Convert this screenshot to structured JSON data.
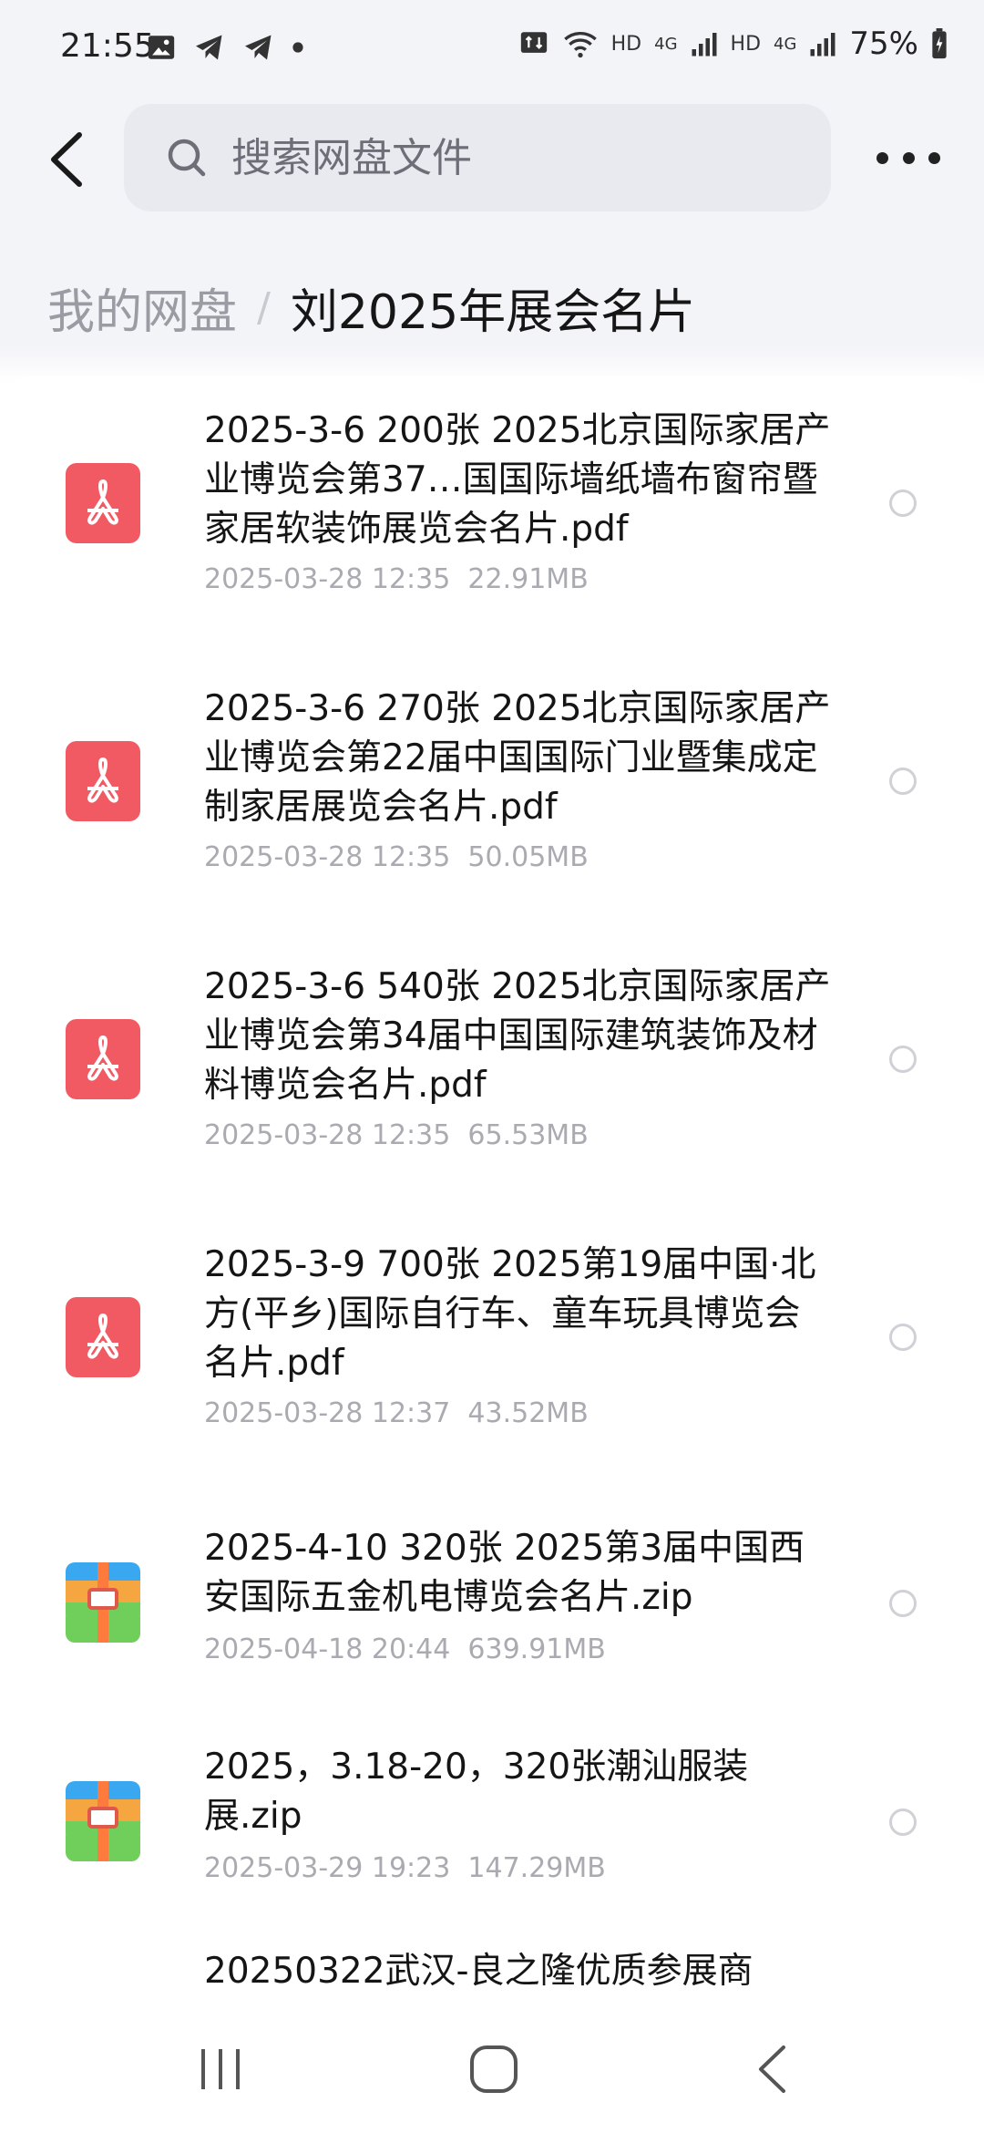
{
  "status_bar": {
    "time": "21:55",
    "net_hd1": "HD",
    "net_4g1": "4G",
    "net_hd2": "HD",
    "net_4g2": "4G",
    "battery": "75%"
  },
  "search": {
    "placeholder": "搜索网盘文件"
  },
  "breadcrumb": {
    "root": "我的网盘",
    "separator": "/",
    "current": "刘2025年展会名片"
  },
  "files": [
    {
      "type": "pdf",
      "name": "2025-3-6 200张 2025北京国际家居产业博览会第37…国国际墙纸墙布窗帘暨家居软装饰展览会名片.pdf",
      "date": "2025-03-28 12:35",
      "size": "22.91MB"
    },
    {
      "type": "pdf",
      "name": "2025-3-6 270张 2025北京国际家居产业博览会第22届中国国际门业暨集成定制家居展览会名片.pdf",
      "date": "2025-03-28 12:35",
      "size": "50.05MB"
    },
    {
      "type": "pdf",
      "name": "2025-3-6 540张 2025北京国际家居产业博览会第34届中国国际建筑装饰及材料博览会名片.pdf",
      "date": "2025-03-28 12:35",
      "size": "65.53MB"
    },
    {
      "type": "pdf",
      "name": "2025-3-9 700张 2025第19届中国·北方(平乡)国际自行车、童车玩具博览会名片.pdf",
      "date": "2025-03-28 12:37",
      "size": "43.52MB"
    },
    {
      "type": "zip",
      "name": "2025-4-10 320张 2025第3届中国西安国际五金机电博览会名片.zip",
      "date": "2025-04-18 20:44",
      "size": "639.91MB"
    },
    {
      "type": "zip",
      "name": "2025，3.18-20，320张潮汕服装展.zip",
      "date": "2025-03-29 19:23",
      "size": "147.29MB"
    },
    {
      "type": "zip",
      "name": "20250322武汉-良之隆优质参展商",
      "date": "",
      "size": ""
    }
  ],
  "colors": {
    "pdf_icon": "#f25a63",
    "accent": "#1d6bff"
  }
}
